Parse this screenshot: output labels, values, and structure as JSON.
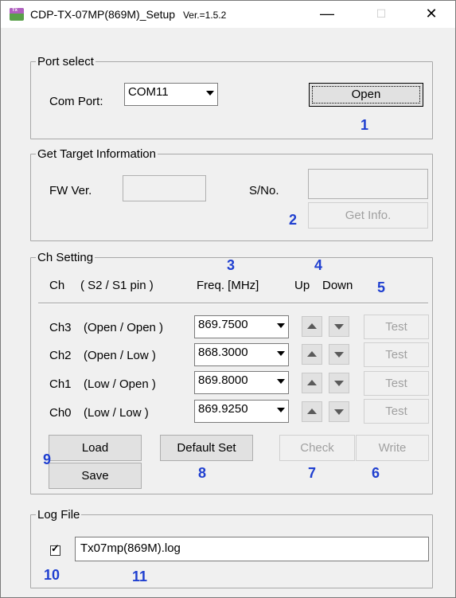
{
  "window": {
    "title": "CDP-TX-07MP(869M)_Setup",
    "version": "Ver.=1.5.2",
    "icon_text": "Tx",
    "minimize": "—",
    "maximize": "☐",
    "close": "✕"
  },
  "port_select": {
    "legend": "Port select",
    "com_port_label": "Com Port:",
    "com_port_value": "COM11",
    "open_button": "Open",
    "marker": "1"
  },
  "target_info": {
    "legend": "Get Target Information",
    "fw_label": "FW Ver.",
    "fw_value": "",
    "sn_label": "S/No.",
    "sn_value": "",
    "get_info_button": "Get Info.",
    "marker": "2"
  },
  "ch_setting": {
    "legend": "Ch Setting",
    "header_ch": "Ch",
    "header_pins": "( S2 / S1 pin )",
    "header_freq": "Freq. [MHz]",
    "header_up": "Up",
    "header_down": "Down",
    "marker_freq": "3",
    "marker_updown": "4",
    "marker_test": "5",
    "rows": [
      {
        "ch": "Ch3",
        "pins": "(Open / Open )",
        "freq": "869.7500",
        "test": "Test"
      },
      {
        "ch": "Ch2",
        "pins": "(Open / Low   )",
        "freq": "868.3000",
        "test": "Test"
      },
      {
        "ch": "Ch1",
        "pins": "(Low   / Open )",
        "freq": "869.8000",
        "test": "Test"
      },
      {
        "ch": "Ch0",
        "pins": "(Low  /  Low   )",
        "freq": "869.9250",
        "test": "Test"
      }
    ],
    "load_button": "Load",
    "save_button": "Save",
    "default_set_button": "Default Set",
    "check_button": "Check",
    "write_button": "Write",
    "marker_loadsave": "9",
    "marker_default": "8",
    "marker_check": "7",
    "marker_write": "6"
  },
  "log_file": {
    "legend": "Log File",
    "checkbox_mark": "✓",
    "checked": true,
    "filename": "Tx07mp(869M).log",
    "marker_checkbox": "10",
    "marker_filename": "11"
  },
  "colors": {
    "marker": "#1f3fd0",
    "window_bg": "#f0f0f0",
    "disabled_text": "#a0a0a0"
  }
}
